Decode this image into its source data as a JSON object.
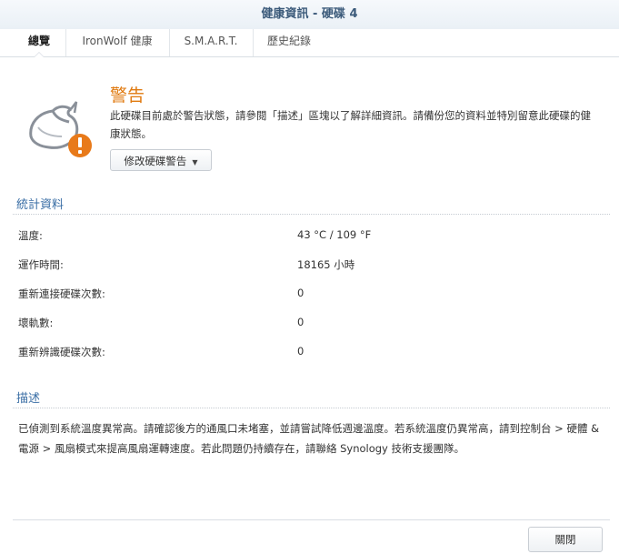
{
  "window": {
    "title": "健康資訊 - 硬碟 4"
  },
  "tabs": [
    {
      "label": "總覽",
      "active": true
    },
    {
      "label": "IronWolf 健康",
      "active": false
    },
    {
      "label": "S.M.A.R.T.",
      "active": false
    },
    {
      "label": "歷史紀錄",
      "active": false
    }
  ],
  "status": {
    "icon": "drive-warning-icon",
    "title": "警告",
    "message": "此硬碟目前處於警告狀態，請參閱「描述」區塊以了解詳細資訊。請備份您的資料並特別留意此硬碟的健康狀態。",
    "modify_button": "修改硬碟警告",
    "accent_color": "#e07a10"
  },
  "stats": {
    "title": "統計資料",
    "rows": [
      {
        "label": "溫度:",
        "value": "43 °C / 109 °F"
      },
      {
        "label": "運作時間:",
        "value": "18165 小時"
      },
      {
        "label": "重新連接硬碟次數:",
        "value": "0"
      },
      {
        "label": "壞軌數:",
        "value": "0"
      },
      {
        "label": "重新辨識硬碟次數:",
        "value": "0"
      }
    ]
  },
  "description": {
    "title": "描述",
    "text": "已偵測到系統溫度異常高。請確認後方的通風口未堵塞，並請嘗試降低週邊溫度。若系統溫度仍異常高，請到控制台 > 硬體 & 電源 > 風扇模式來提高風扇運轉速度。若此問題仍持續存在，請聯絡 Synology 技術支援團隊。"
  },
  "footer": {
    "close_button": "關閉"
  }
}
